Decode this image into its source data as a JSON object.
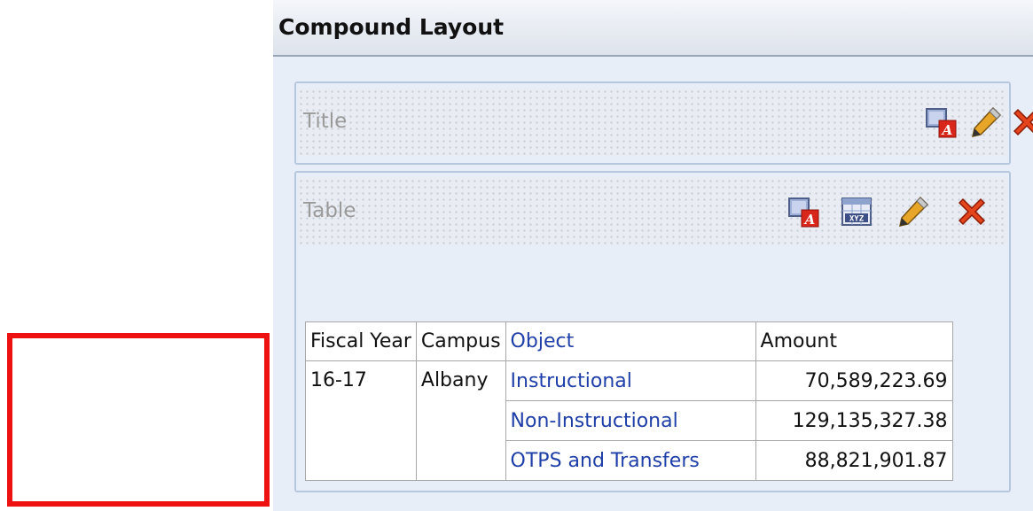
{
  "panel": {
    "title": "Compound Layout"
  },
  "views": {
    "title_view": {
      "label": "Title",
      "icons": [
        "format-view-icon",
        "edit-pencil-icon",
        "delete-x-icon"
      ]
    },
    "table_view": {
      "label": "Table",
      "icons": [
        "format-view-icon",
        "table-properties-icon",
        "edit-pencil-icon",
        "delete-x-icon"
      ]
    }
  },
  "table": {
    "headers": [
      "Fiscal Year",
      "Campus",
      "Object",
      "Amount"
    ],
    "fiscal_year": "16-17",
    "campus": "Albany",
    "rows": [
      {
        "object": "Instructional",
        "amount": "70,589,223.69"
      },
      {
        "object": "Non-Instructional",
        "amount": "129,135,327.38"
      },
      {
        "object": "OTPS and Transfers",
        "amount": "88,821,901.87"
      }
    ]
  },
  "colors": {
    "highlight_box": "#ee1111",
    "link_blue": "#1f3fa8",
    "panel_bg": "#e8eef7"
  }
}
